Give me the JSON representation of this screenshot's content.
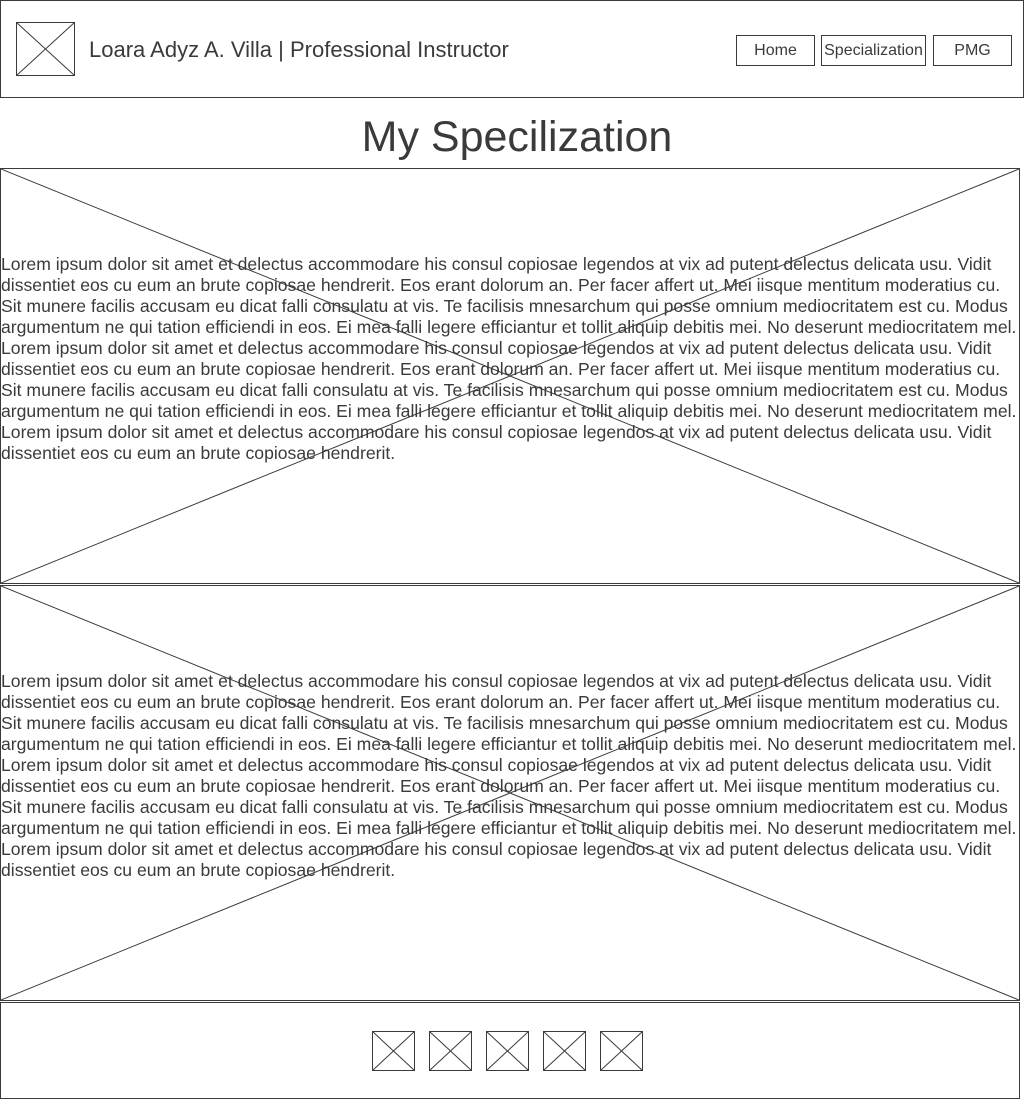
{
  "header": {
    "logo_icon": "image-placeholder-icon",
    "title": "Loara Adyz A. Villa | Professional Instructor",
    "nav": [
      {
        "label": "Home"
      },
      {
        "label": "Specialization"
      },
      {
        "label": "PMG"
      }
    ]
  },
  "main": {
    "title": "My Specilization",
    "sections": [
      {
        "background_icon": "image-placeholder-icon",
        "text": "Lorem ipsum dolor sit amet et delectus accommodare his consul copiosae legendos at vix ad putent delectus delicata usu. Vidit dissentiet eos cu eum an brute copiosae hendrerit. Eos erant dolorum an. Per facer affert ut. Mei iisque mentitum moderatius cu. Sit munere facilis accusam eu dicat falli consulatu at vis. Te facilisis mnesarchum qui posse omnium mediocritatem est cu. Modus argumentum ne qui tation efficiendi in eos. Ei mea falli legere efficiantur et tollit aliquip debitis mei. No deserunt mediocritatem mel. Lorem ipsum dolor sit amet et delectus accommodare his consul copiosae legendos at vix ad putent delectus delicata usu. Vidit dissentiet eos cu eum an brute copiosae hendrerit. Eos erant dolorum an. Per facer affert ut. Mei iisque mentitum moderatius cu. Sit munere facilis accusam eu dicat falli consulatu at vis. Te facilisis mnesarchum qui posse omnium mediocritatem est cu. Modus argumentum ne qui tation efficiendi in eos. Ei mea falli legere efficiantur et tollit aliquip debitis mei. No deserunt mediocritatem mel. Lorem ipsum dolor sit amet et delectus accommodare his consul copiosae legendos at vix ad putent delectus delicata usu. Vidit dissentiet eos cu eum an brute copiosae hendrerit."
      },
      {
        "background_icon": "image-placeholder-icon",
        "text": "Lorem ipsum dolor sit amet et delectus accommodare his consul copiosae legendos at vix ad putent delectus delicata usu. Vidit dissentiet eos cu eum an brute copiosae hendrerit. Eos erant dolorum an. Per facer affert ut. Mei iisque mentitum moderatius cu. Sit munere facilis accusam eu dicat falli consulatu at vis. Te facilisis mnesarchum qui posse omnium mediocritatem est cu. Modus argumentum ne qui tation efficiendi in eos. Ei mea falli legere efficiantur et tollit aliquip debitis mei. No deserunt mediocritatem mel. Lorem ipsum dolor sit amet et delectus accommodare his consul copiosae legendos at vix ad putent delectus delicata usu. Vidit dissentiet eos cu eum an brute copiosae hendrerit. Eos erant dolorum an. Per facer affert ut. Mei iisque mentitum moderatius cu. Sit munere facilis accusam eu dicat falli consulatu at vis. Te facilisis mnesarchum qui posse omnium mediocritatem est cu. Modus argumentum ne qui tation efficiendi in eos. Ei mea falli legere efficiantur et tollit aliquip debitis mei. No deserunt mediocritatem mel. Lorem ipsum dolor sit amet et delectus accommodare his consul copiosae legendos at vix ad putent delectus delicata usu. Vidit dissentiet eos cu eum an brute copiosae hendrerit."
      }
    ]
  },
  "footer": {
    "social_icons": [
      "image-placeholder-icon",
      "image-placeholder-icon",
      "image-placeholder-icon",
      "image-placeholder-icon",
      "image-placeholder-icon"
    ]
  },
  "colors": {
    "line": "#3a3a3a",
    "background": "#ffffff"
  }
}
